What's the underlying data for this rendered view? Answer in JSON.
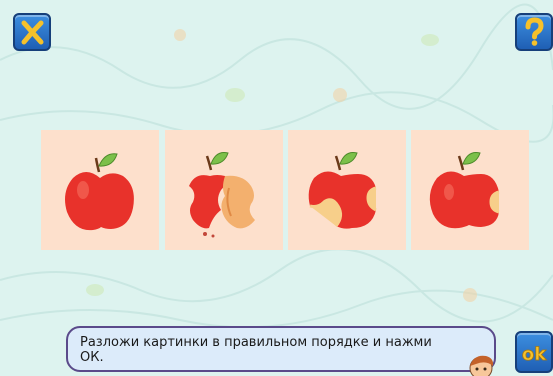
{
  "instruction": {
    "text": "Разложи картинки в правильном порядке и нажми ОК."
  },
  "buttons": {
    "close_icon": "x-icon",
    "help_icon": "question-icon",
    "ok_label": "ok"
  },
  "cards": [
    {
      "name": "whole-apple",
      "bites": 0
    },
    {
      "name": "apple-core",
      "bites": 3
    },
    {
      "name": "apple-two-bites",
      "bites": 2
    },
    {
      "name": "apple-one-bite",
      "bites": 1
    }
  ],
  "colors": {
    "background": "#ddf3ef",
    "card": "#fde0cc",
    "button_blue": "#2a72cc",
    "button_glyph": "#f6c12a",
    "apple_red": "#e8322b",
    "leaf_green": "#7cc04a"
  }
}
